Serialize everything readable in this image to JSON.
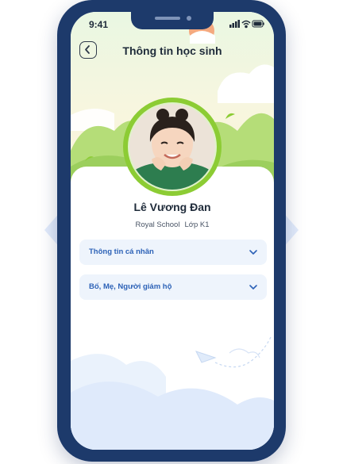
{
  "status_bar": {
    "time": "9:41"
  },
  "header": {
    "title": "Thông tin học sinh",
    "back_icon": "chevron-left-icon"
  },
  "student": {
    "name": "Lê Vương Đan",
    "school": "Royal School",
    "class": "Lớp K1"
  },
  "sections": [
    {
      "label": "Thông tin cá nhân",
      "icon": "chevron-down-icon"
    },
    {
      "label": "Bố, Mẹ, Người giám hộ",
      "icon": "chevron-down-icon"
    }
  ],
  "colors": {
    "frame": "#1d3a6b",
    "accent_blue": "#2d62b7",
    "section_bg": "#eef4fc",
    "avatar_ring": "#8ccc34",
    "hill_green": "#b5dd78"
  }
}
